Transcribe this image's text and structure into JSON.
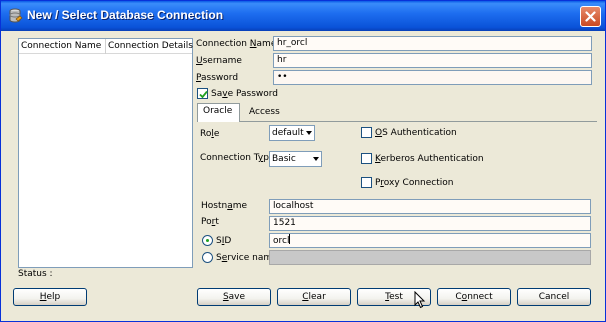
{
  "window": {
    "title": "New / Select Database Connection",
    "icon": "database-icon",
    "close": "close-icon"
  },
  "connections_table": {
    "columns": [
      "Connection Name",
      "Connection Details"
    ],
    "rows": []
  },
  "form": {
    "connection_name": {
      "label": "Connection Name",
      "mnemonic": "N",
      "value": "hr_orcl"
    },
    "username": {
      "label": "Username",
      "mnemonic": "U",
      "value": "hr"
    },
    "password": {
      "label": "Password",
      "mnemonic": "P",
      "value": "••"
    },
    "save_password": {
      "label": "Save Password",
      "mnemonic": "v",
      "checked": true
    }
  },
  "tabs": [
    {
      "label": "Oracle",
      "active": true
    },
    {
      "label": "Access",
      "active": false
    }
  ],
  "oracle": {
    "role": {
      "label": "Role",
      "mnemonic": "l",
      "value": "default"
    },
    "connection_type": {
      "label": "Connection Type",
      "mnemonic": "y",
      "value": "Basic"
    },
    "os_auth": {
      "label": "OS Authentication",
      "mnemonic": "O",
      "checked": false
    },
    "kerberos_auth": {
      "label": "Kerberos Authentication",
      "mnemonic": "K",
      "checked": false
    },
    "proxy_connection": {
      "label": "Proxy Connection",
      "mnemonic": "r",
      "checked": false
    },
    "hostname": {
      "label": "Hostname",
      "mnemonic": "a",
      "value": "localhost"
    },
    "port": {
      "label": "Port",
      "mnemonic": "r",
      "value": "1521"
    },
    "sid": {
      "label": "SID",
      "mnemonic": "I",
      "value": "orcl",
      "selected": true
    },
    "service_name": {
      "label": "Service name",
      "mnemonic": "e",
      "value": "",
      "selected": false
    }
  },
  "status": {
    "label": "Status :"
  },
  "buttons": {
    "help": {
      "label": "Help",
      "mnemonic": "H"
    },
    "save": {
      "label": "Save",
      "mnemonic": "S"
    },
    "clear": {
      "label": "Clear",
      "mnemonic": "C"
    },
    "test": {
      "label": "Test",
      "mnemonic": "T"
    },
    "connect": {
      "label": "Connect",
      "mnemonic": "o"
    },
    "cancel": {
      "label": "Cancel"
    }
  },
  "colors": {
    "title_bar": "#0a52d8",
    "dialog_bg": "#ece9d8",
    "field_border": "#7f9db9",
    "radio_dot": "#21a121"
  }
}
